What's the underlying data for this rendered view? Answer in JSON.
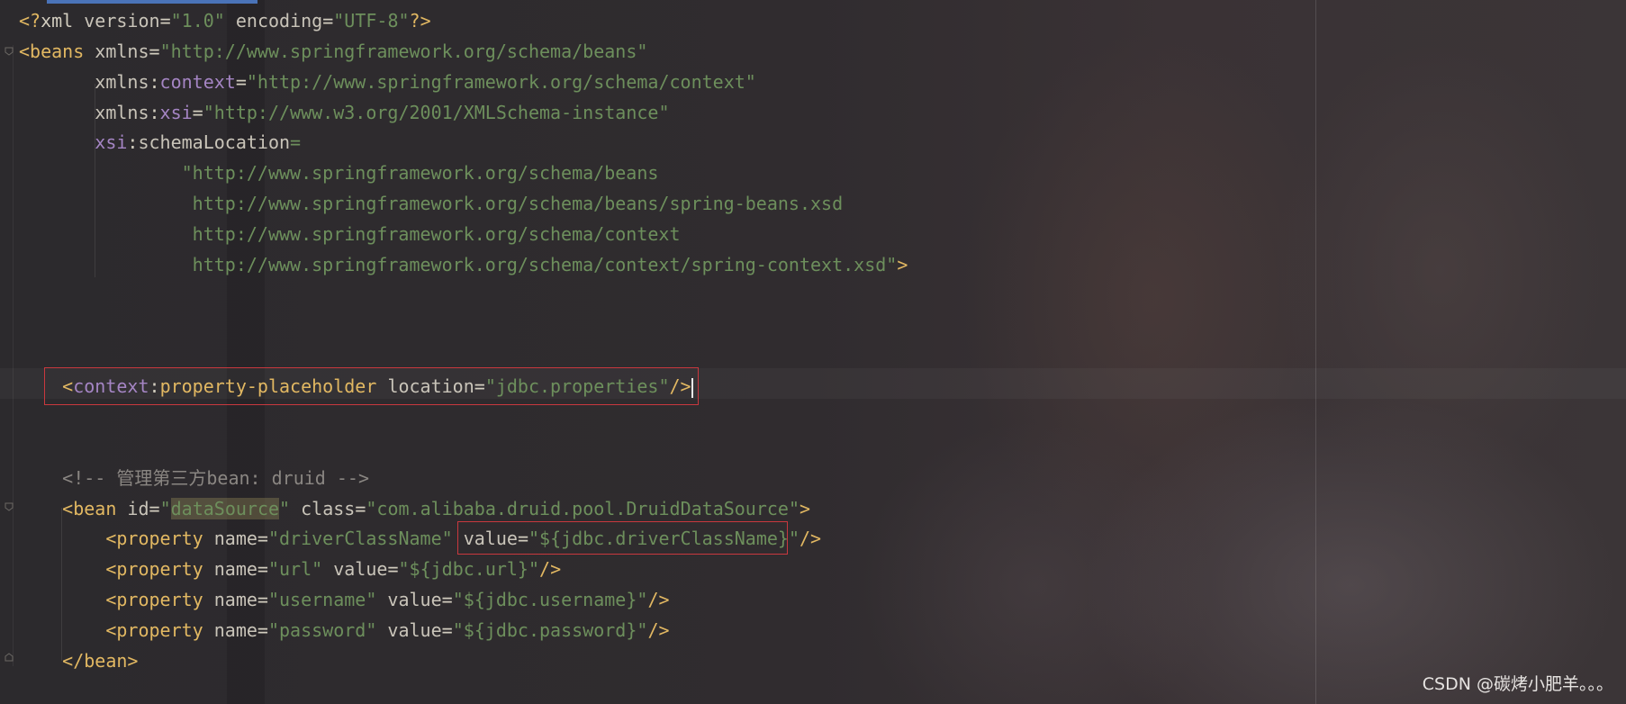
{
  "editor": {
    "language": "XML",
    "lines": [
      {
        "parts": [
          {
            "t": "<?",
            "c": "tag"
          },
          {
            "t": "xml ",
            "c": "pn"
          },
          {
            "t": "version",
            "c": "attr"
          },
          {
            "t": "=",
            "c": "pn"
          },
          {
            "t": "\"1.0\"",
            "c": "str"
          },
          {
            "t": " encoding",
            "c": "attr"
          },
          {
            "t": "=",
            "c": "pn"
          },
          {
            "t": "\"UTF-8\"",
            "c": "str"
          },
          {
            "t": "?>",
            "c": "tag"
          }
        ]
      },
      {
        "parts": [
          {
            "t": "<beans ",
            "c": "tag"
          },
          {
            "t": "xmlns",
            "c": "attr"
          },
          {
            "t": "=",
            "c": "pn"
          },
          {
            "t": "\"http://www.springframework.org/schema/beans\"",
            "c": "str"
          }
        ]
      },
      {
        "parts": [
          {
            "t": "       xmlns",
            "c": "attr"
          },
          {
            "t": ":",
            "c": "pn"
          },
          {
            "t": "context",
            "c": "ns"
          },
          {
            "t": "=",
            "c": "pn"
          },
          {
            "t": "\"http://www.springframework.org/schema/context\"",
            "c": "str"
          }
        ]
      },
      {
        "parts": [
          {
            "t": "       xmlns",
            "c": "attr"
          },
          {
            "t": ":",
            "c": "pn"
          },
          {
            "t": "xsi",
            "c": "ns"
          },
          {
            "t": "=",
            "c": "pn"
          },
          {
            "t": "\"http://www.w3.org/2001/XMLSchema-instance\"",
            "c": "str"
          }
        ]
      },
      {
        "parts": [
          {
            "t": "       ",
            "c": "pn"
          },
          {
            "t": "xsi",
            "c": "ns"
          },
          {
            "t": ":",
            "c": "pn"
          },
          {
            "t": "schemaLocation",
            "c": "attr"
          },
          {
            "t": "=",
            "c": "str"
          }
        ]
      },
      {
        "parts": [
          {
            "t": "               \"http://www.springframework.org/schema/beans",
            "c": "str"
          }
        ]
      },
      {
        "parts": [
          {
            "t": "                http://www.springframework.org/schema/beans/spring-beans.xsd",
            "c": "str"
          }
        ]
      },
      {
        "parts": [
          {
            "t": "                http://www.springframework.org/schema/context",
            "c": "str"
          }
        ]
      },
      {
        "parts": [
          {
            "t": "                http://www.springframework.org/schema/context/spring-context.xsd\"",
            "c": "str"
          },
          {
            "t": ">",
            "c": "tag"
          }
        ]
      },
      {
        "parts": []
      },
      {
        "parts": []
      },
      {
        "parts": []
      },
      {
        "parts": [
          {
            "t": "    ",
            "c": "pn"
          },
          {
            "t": "<",
            "c": "tag"
          },
          {
            "t": "context",
            "c": "ns"
          },
          {
            "t": ":",
            "c": "pn"
          },
          {
            "t": "property-placeholder ",
            "c": "tag"
          },
          {
            "t": "location",
            "c": "attr"
          },
          {
            "t": "=",
            "c": "pn"
          },
          {
            "t": "\"jdbc.properties\"",
            "c": "str"
          },
          {
            "t": "/>",
            "c": "tag"
          },
          {
            "t": "",
            "c": "cursor"
          }
        ]
      },
      {
        "parts": []
      },
      {
        "parts": []
      },
      {
        "parts": [
          {
            "t": "    <!-- 管理第三方bean: druid -->",
            "c": "cmt"
          }
        ]
      },
      {
        "parts": [
          {
            "t": "    <bean ",
            "c": "tag"
          },
          {
            "t": "id",
            "c": "attr"
          },
          {
            "t": "=",
            "c": "pn"
          },
          {
            "t": "\"",
            "c": "str"
          },
          {
            "t": "dataSource",
            "c": "str hl"
          },
          {
            "t": "\"",
            "c": "str"
          },
          {
            "t": " class",
            "c": "attr"
          },
          {
            "t": "=",
            "c": "pn"
          },
          {
            "t": "\"com.alibaba.druid.pool.DruidDataSource\"",
            "c": "str"
          },
          {
            "t": ">",
            "c": "tag"
          }
        ]
      },
      {
        "parts": [
          {
            "t": "        <property ",
            "c": "tag"
          },
          {
            "t": "name",
            "c": "attr"
          },
          {
            "t": "=",
            "c": "pn"
          },
          {
            "t": "\"driverClassName\"",
            "c": "str"
          },
          {
            "t": " ",
            "c": "pn"
          },
          {
            "t": "value",
            "c": "attr"
          },
          {
            "t": "=",
            "c": "pn"
          },
          {
            "t": "\"${jdbc.driverClassName}",
            "c": "str"
          },
          {
            "t": "\"",
            "c": "str"
          },
          {
            "t": "/>",
            "c": "tag"
          }
        ]
      },
      {
        "parts": [
          {
            "t": "        <property ",
            "c": "tag"
          },
          {
            "t": "name",
            "c": "attr"
          },
          {
            "t": "=",
            "c": "pn"
          },
          {
            "t": "\"url\"",
            "c": "str"
          },
          {
            "t": " value",
            "c": "attr"
          },
          {
            "t": "=",
            "c": "pn"
          },
          {
            "t": "\"${jdbc.url}\"",
            "c": "str"
          },
          {
            "t": "/>",
            "c": "tag"
          }
        ]
      },
      {
        "parts": [
          {
            "t": "        <property ",
            "c": "tag"
          },
          {
            "t": "name",
            "c": "attr"
          },
          {
            "t": "=",
            "c": "pn"
          },
          {
            "t": "\"username\"",
            "c": "str"
          },
          {
            "t": " value",
            "c": "attr"
          },
          {
            "t": "=",
            "c": "pn"
          },
          {
            "t": "\"${jdbc.username}\"",
            "c": "str"
          },
          {
            "t": "/>",
            "c": "tag"
          }
        ]
      },
      {
        "parts": [
          {
            "t": "        <property ",
            "c": "tag"
          },
          {
            "t": "name",
            "c": "attr"
          },
          {
            "t": "=",
            "c": "pn"
          },
          {
            "t": "\"password\"",
            "c": "str"
          },
          {
            "t": " value",
            "c": "attr"
          },
          {
            "t": "=",
            "c": "pn"
          },
          {
            "t": "\"${jdbc.password}\"",
            "c": "str"
          },
          {
            "t": "/>",
            "c": "tag"
          }
        ]
      },
      {
        "parts": [
          {
            "t": "    </bean>",
            "c": "tag"
          }
        ]
      }
    ]
  },
  "watermark": "CSDN @碳烤小肥羊。。。",
  "colors": {
    "background": "#2f2b2e",
    "tag": "#e2b862",
    "namespace": "#a585c4",
    "string": "#6d8f5c",
    "comment": "#8a8682",
    "annotation_box": "#c9383e",
    "tab_indicator": "#4a73b8"
  }
}
